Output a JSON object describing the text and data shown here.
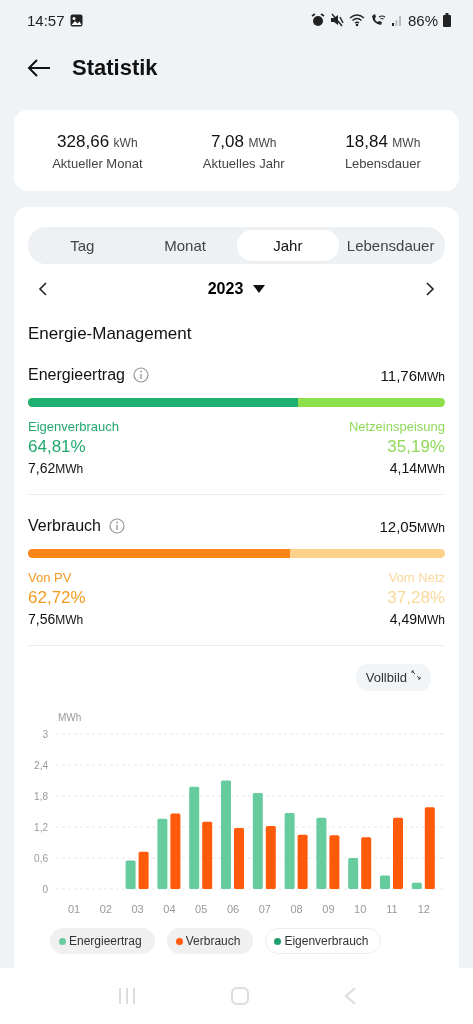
{
  "status_bar": {
    "time": "14:57",
    "battery": "86%"
  },
  "header": {
    "title": "Statistik"
  },
  "summary": [
    {
      "value": "328,66",
      "unit": "kWh",
      "label": "Aktueller Monat"
    },
    {
      "value": "7,08",
      "unit": "MWh",
      "label": "Aktuelles Jahr"
    },
    {
      "value": "18,84",
      "unit": "MWh",
      "label": "Lebensdauer"
    }
  ],
  "tabs": [
    {
      "label": "Tag",
      "selected": false
    },
    {
      "label": "Monat",
      "selected": false
    },
    {
      "label": "Jahr",
      "selected": true
    },
    {
      "label": "Lebensdauer",
      "selected": false
    }
  ],
  "period": {
    "label": "2023"
  },
  "section_title": "Energie-Management",
  "breakdowns": [
    {
      "kind": "yield",
      "title": "Energieertrag",
      "total": "11,76",
      "unit": "MWh",
      "level": 0.6481,
      "left": {
        "label": "Eigenverbrauch",
        "percent": "64,81%",
        "value": "7,62",
        "unit": "MWh"
      },
      "right": {
        "label": "Netzeinspeisung",
        "percent": "35,19%",
        "value": "4,14",
        "unit": "MWh"
      }
    },
    {
      "kind": "consumption",
      "title": "Verbrauch",
      "total": "12,05",
      "unit": "MWh",
      "level": 0.6272,
      "left": {
        "label": "Von PV",
        "percent": "62,72%",
        "value": "7,56",
        "unit": "MWh"
      },
      "right": {
        "label": "Vom Netz",
        "percent": "37,28%",
        "value": "4,49",
        "unit": "MWh"
      }
    }
  ],
  "fullscreen_button": "Vollbild",
  "chart_data": {
    "type": "bar",
    "ylabel": "MWh",
    "categories": [
      "01",
      "02",
      "03",
      "04",
      "05",
      "06",
      "07",
      "08",
      "09",
      "10",
      "11",
      "12"
    ],
    "ylim": [
      0,
      3
    ],
    "yticks": [
      {
        "value": 0,
        "label": "0"
      },
      {
        "value": 0.6,
        "label": "0,6"
      },
      {
        "value": 1.2,
        "label": "1,2"
      },
      {
        "value": 1.8,
        "label": "1,8"
      },
      {
        "value": 2.4,
        "label": "2,4"
      },
      {
        "value": 3,
        "label": "3"
      }
    ],
    "grid": true,
    "series": [
      {
        "name": "Energieertrag",
        "color": "#66cc9d",
        "values": [
          0,
          0,
          0.55,
          1.36,
          1.98,
          2.1,
          1.86,
          1.47,
          1.38,
          0.6,
          0.26,
          0.12
        ]
      },
      {
        "name": "Verbrauch",
        "color": "#ff5a0a",
        "values": [
          0,
          0,
          0.72,
          1.46,
          1.3,
          1.18,
          1.22,
          1.05,
          1.04,
          1.0,
          1.38,
          1.58
        ]
      },
      {
        "name": "Eigenverbrauch",
        "color": "#1f9e6e",
        "values": [
          null,
          null,
          null,
          null,
          null,
          null,
          null,
          null,
          null,
          null,
          null,
          null
        ]
      }
    ]
  },
  "legend": [
    {
      "selected": true
    },
    {
      "selected": true
    },
    {
      "selected": false
    }
  ]
}
